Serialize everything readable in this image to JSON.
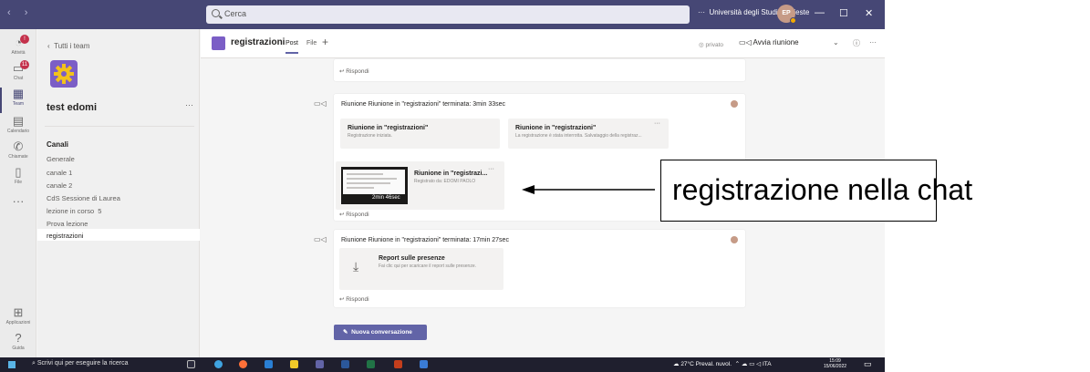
{
  "titlebar": {
    "search_placeholder": "Cerca",
    "org": "Università degli Studi di Trieste",
    "avatar": "EP",
    "more": "···"
  },
  "rail": [
    {
      "label": "Attività",
      "glyph": "◔",
      "badge": "!"
    },
    {
      "label": "Chat",
      "glyph": "▭",
      "badge": "11"
    },
    {
      "label": "Team",
      "glyph": "▦",
      "badge": ""
    },
    {
      "label": "Calendario",
      "glyph": "▤",
      "badge": ""
    },
    {
      "label": "Chiamate",
      "glyph": "✆",
      "badge": ""
    },
    {
      "label": "File",
      "glyph": "▯",
      "badge": ""
    },
    {
      "label": "",
      "glyph": "···",
      "badge": ""
    },
    {
      "label": "Applicazioni",
      "glyph": "⊞",
      "badge": ""
    },
    {
      "label": "Guida",
      "glyph": "?",
      "badge": ""
    }
  ],
  "left": {
    "back": "Tutti i team",
    "team_name": "test edomi",
    "more": "···",
    "section": "Canali",
    "channels": [
      "Generale",
      "canale 1",
      "canale 2",
      "CdS Sessione di Laurea",
      "lezione in corso",
      "Prova lezione",
      "registrazioni"
    ],
    "live_icon": "5"
  },
  "header": {
    "title": "registrazioni",
    "tab_post": "Post",
    "tab_file": "File",
    "plus": "+",
    "privacy": "privato",
    "meet": "Avvia riunione",
    "chevron": "⌄",
    "info": "ⓘ",
    "more": "···"
  },
  "feed": {
    "reply": "Rispondi",
    "post1": {
      "title": "Riunione Riunione in \"registrazioni\" terminata: 3min 33sec",
      "card1_title": "Riunione in \"registrazioni\"",
      "card1_sub": "Registrazione iniziata.",
      "card2_title": "Riunione in \"registrazioni\"",
      "card2_sub": "La registrazione è stata interrotta. Salvataggio della registraz...",
      "card2_more": "···",
      "rec_title": "Riunione in \"registrazi...",
      "rec_sub": "Registrato da: EDOMI PAOLO",
      "rec_more": "···",
      "rec_duration": "2min 46sec"
    },
    "post2": {
      "title": "Riunione Riunione in \"registrazioni\" terminata: 17min 27sec",
      "report_title": "Report sulle presenze",
      "report_sub": "Fai clic qui per scaricare il report sulle presenze."
    },
    "new_conversation": "Nuova conversazione"
  },
  "taskbar": {
    "search": "Scrivi qui per eseguire la ricerca",
    "weather": "27°C Preval. nuvol.",
    "lang": "ITA",
    "time": "15:09",
    "date": "15/06/2022"
  },
  "callout": {
    "text": "registrazione nella chat"
  }
}
